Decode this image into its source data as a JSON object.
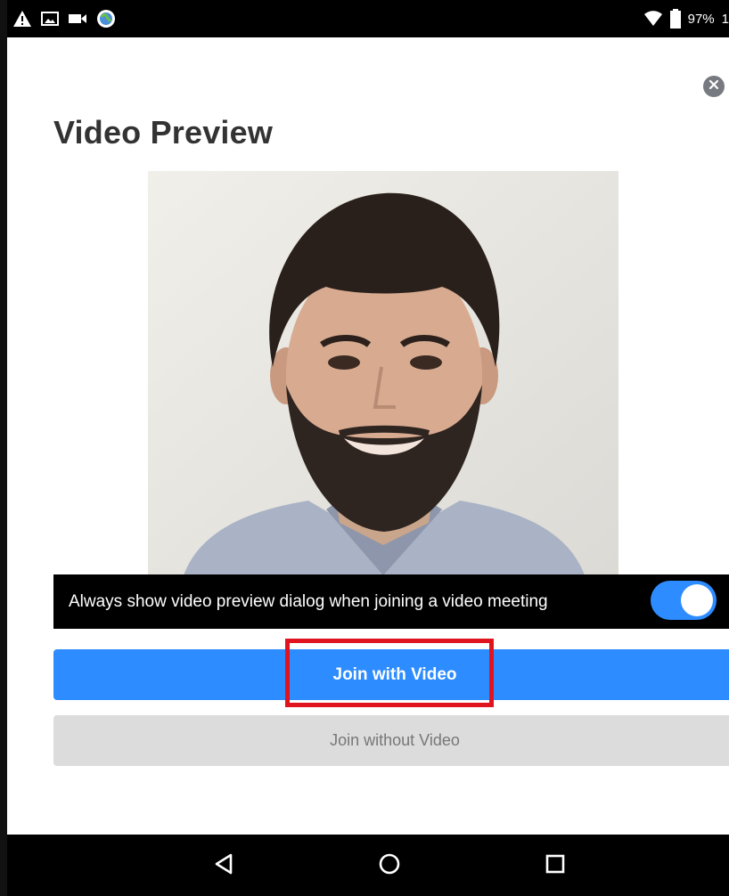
{
  "status_bar": {
    "battery_text": "97%",
    "clock_text": "1",
    "left_icons": [
      "warning-icon",
      "image-icon",
      "video-camera-icon",
      "globe-icon"
    ],
    "right_icons": [
      "wifi-icon",
      "battery-icon"
    ]
  },
  "dialog": {
    "title": "Video Preview",
    "close_icon": "close-icon",
    "toggle": {
      "label": "Always show video preview dialog when joining a video meeting",
      "state": "on"
    },
    "primary_button": "Join with Video",
    "secondary_button": "Join without Video"
  },
  "nav_bar": {
    "icons": [
      "back-icon",
      "home-icon",
      "recents-icon"
    ]
  },
  "colors": {
    "accent": "#2d8cff",
    "highlight": "#e0141e",
    "title": "#333333",
    "secondary_button_bg": "#dcdcdc",
    "secondary_button_text": "#777777"
  }
}
